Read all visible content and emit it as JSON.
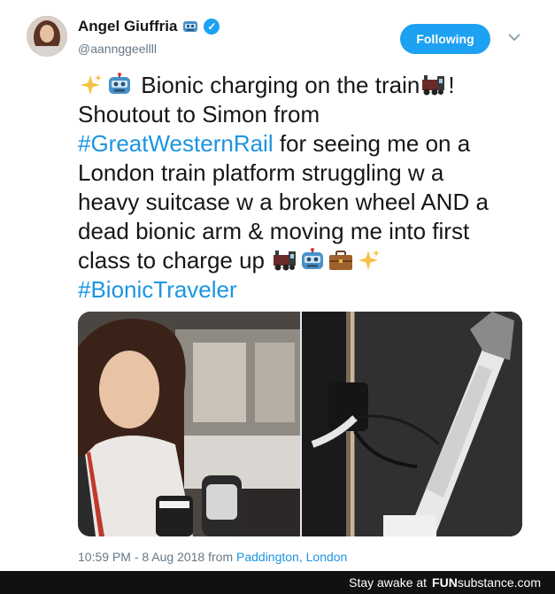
{
  "author": {
    "name": "Angel Giuffria",
    "handle": "@aannggeellll",
    "avatar_icon": "profile-photo"
  },
  "follow_button": {
    "label": "Following"
  },
  "menu": {
    "caret_icon": "chevron-down-icon"
  },
  "tweet": {
    "line1": "Bionic charging on the train",
    "line1_end": "!",
    "line2": "Shoutout to Simon from",
    "hashtag1": "#GreatWesternRail",
    "line3_rest": " for seeing me on a",
    "line4": "London train platform struggling w a",
    "line5": "heavy suitcase w a broken wheel AND a",
    "line6": "dead bionic arm & moving me into first",
    "line7": "class to charge up",
    "hashtag2": "#BionicTraveler"
  },
  "footer": {
    "timestamp": "10:59 PM - 8 Aug 2018 from",
    "location": "Paddington, London"
  },
  "watermark": {
    "prefix": "Stay awake at",
    "brand": "FUN",
    "brand_suffix": "substance",
    "domain": ".com"
  },
  "colors": {
    "accent": "#1da1f2",
    "link": "#1b95e0",
    "text": "#14171a",
    "muted": "#657786"
  }
}
